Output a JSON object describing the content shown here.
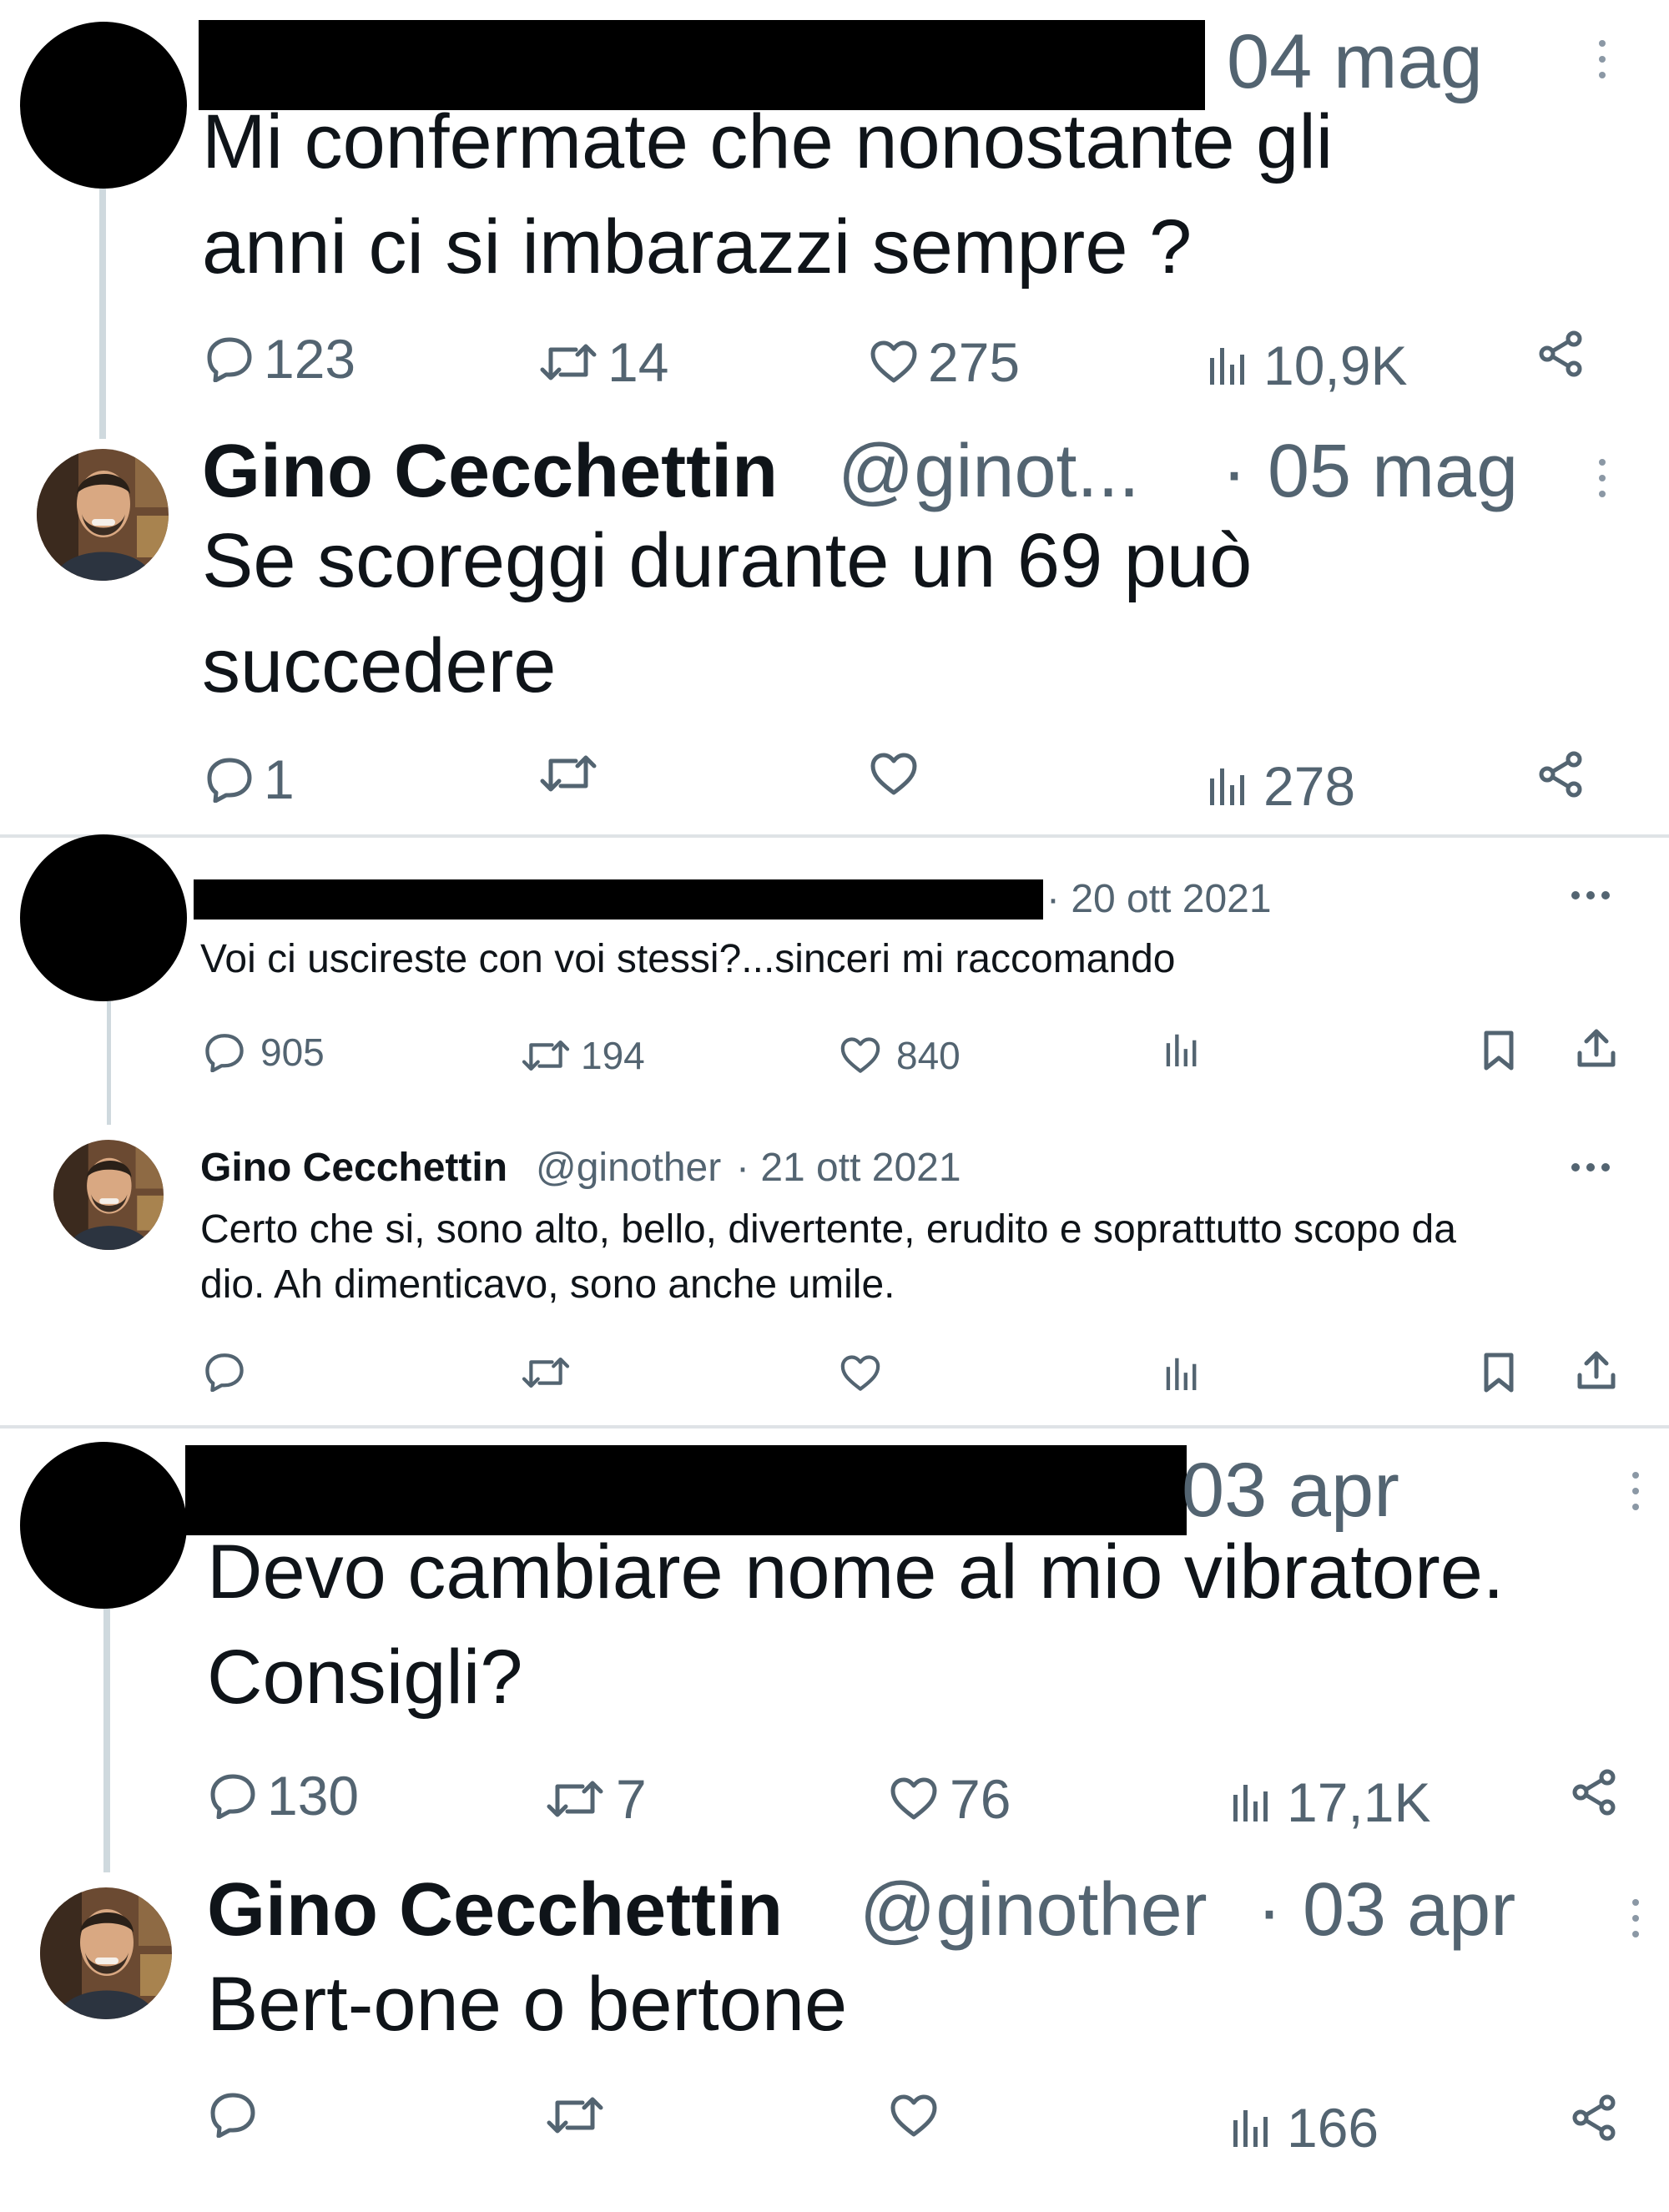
{
  "panel1": {
    "tweet": {
      "date": "04 mag",
      "text_line1": "Mi confermate che nonostante gli",
      "text_line2": "anni ci si imbarazzi sempre ?",
      "replies": "123",
      "retweets": "14",
      "likes": "275",
      "views": "10,9K"
    },
    "reply": {
      "name": "Gino Cecchettin",
      "handle": "@ginot...",
      "date": "· 05 mag",
      "text_line1": "Se scoreggi durante un 69 può",
      "text_line2": "succedere",
      "replies": "1",
      "views": "278"
    }
  },
  "panel2": {
    "tweet": {
      "date": "· 20 ott 2021",
      "text": "Voi ci uscireste con voi stessi?...sinceri mi raccomando",
      "replies": "905",
      "retweets": "194",
      "likes": "840"
    },
    "reply": {
      "name": "Gino Cecchettin",
      "handle": "@ginother",
      "date": "· 21 ott 2021",
      "text_line1": "Certo che si, sono alto, bello, divertente, erudito e soprattutto scopo da",
      "text_line2": "dio. Ah dimenticavo, sono anche umile."
    }
  },
  "panel3": {
    "tweet": {
      "date": "03 apr",
      "text_line1": "Devo cambiare nome al mio vibratore.",
      "text_line2": "Consigli?",
      "replies": "130",
      "retweets": "7",
      "likes": "76",
      "views": "17,1K"
    },
    "reply": {
      "name": "Gino Cecchettin",
      "handle": "@ginother",
      "date": "· 03 apr",
      "text": "Bert-one o bertone",
      "views": "166"
    }
  },
  "icons": [
    "reply-icon",
    "retweet-icon",
    "like-icon",
    "views-icon",
    "share-icon",
    "bookmark-icon",
    "upload-icon",
    "more-icon"
  ],
  "colors": {
    "text": "#0f1419",
    "muted": "#536471",
    "thread_line": "#cfd9de",
    "redaction": "#000000"
  }
}
